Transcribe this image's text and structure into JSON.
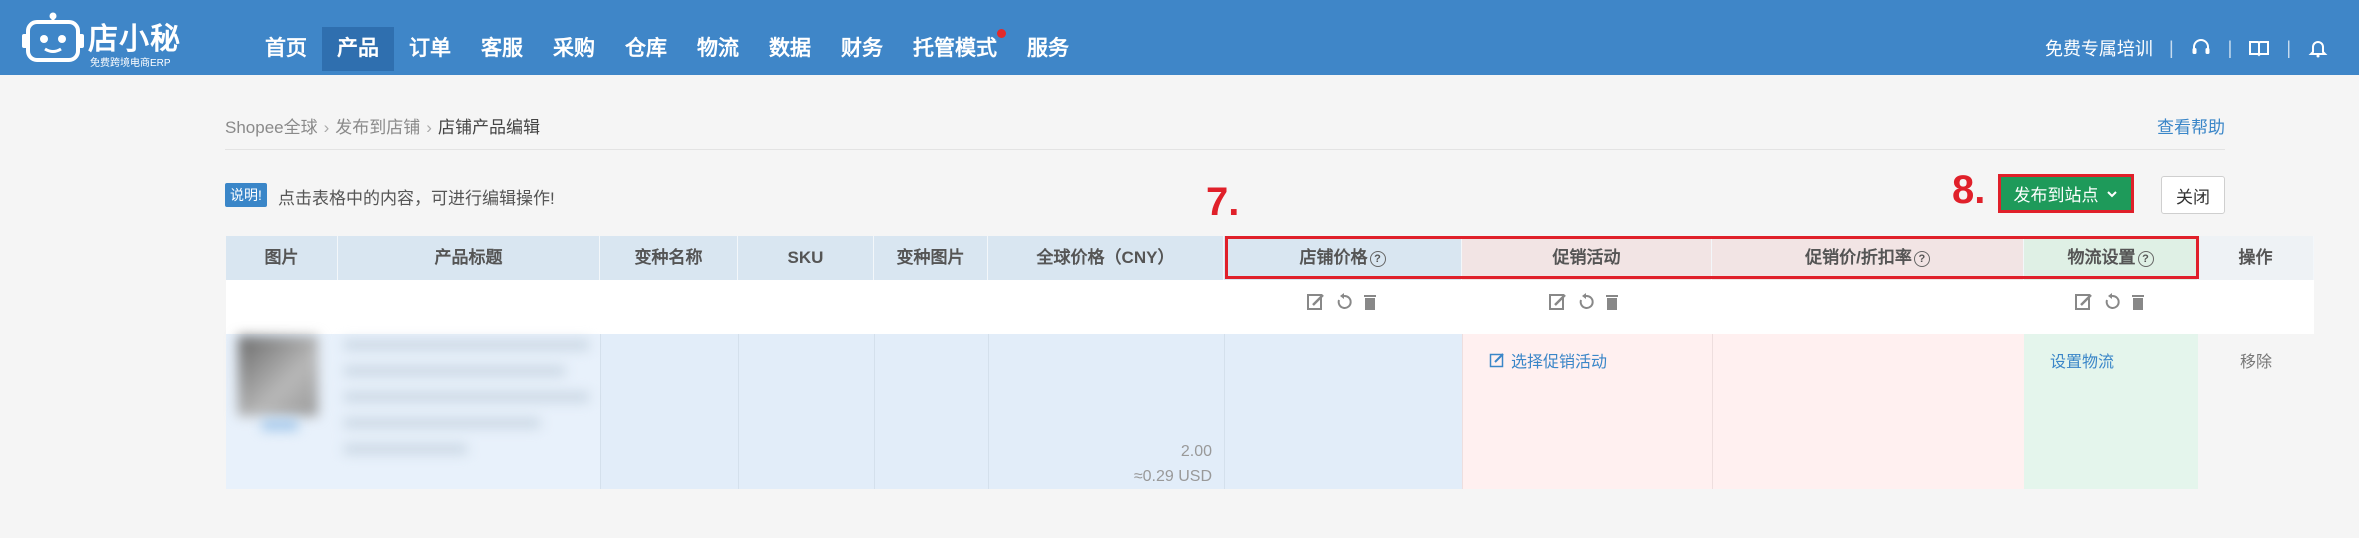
{
  "app": {
    "logo_name": "店小秘",
    "logo_sub": "免费跨境电商ERP"
  },
  "nav": {
    "items": [
      {
        "label": "首页"
      },
      {
        "label": "产品"
      },
      {
        "label": "订单"
      },
      {
        "label": "客服"
      },
      {
        "label": "采购"
      },
      {
        "label": "仓库"
      },
      {
        "label": "物流"
      },
      {
        "label": "数据"
      },
      {
        "label": "财务"
      },
      {
        "label": "托管模式"
      },
      {
        "label": "服务"
      }
    ],
    "active": "产品",
    "right_link": "免费专属培训",
    "icons": [
      "headset-icon",
      "book-icon",
      "bell-icon"
    ]
  },
  "breadcrumb": {
    "items": [
      "Shopee全球",
      "发布到店铺",
      "店铺产品编辑"
    ],
    "help": "查看帮助"
  },
  "notice": {
    "badge": "说明!",
    "text": "点击表格中的内容，可进行编辑操作!"
  },
  "annotations": {
    "step7": "7.",
    "step8": "8."
  },
  "actions": {
    "publish": "发布到站点",
    "close": "关闭"
  },
  "table": {
    "headers": [
      "图片",
      "产品标题",
      "变种名称",
      "SKU",
      "变种图片",
      "全球价格（CNY）",
      "店铺价格",
      "促销活动",
      "促销价/折扣率",
      "物流设置",
      "操作"
    ],
    "row": {
      "global_price": "2.00",
      "global_price_usd": "≈0.29 USD",
      "promo_action": "选择促销活动",
      "shipping_action": "设置物流",
      "remove": "移除"
    }
  },
  "colors": {
    "topbar": "#3f86c8",
    "header_blue": "#d9e6f1",
    "header_pink": "#f2e4e4",
    "header_green": "#dff0e5",
    "col_blue": "#e2edf9",
    "col_pink": "#fff0f0",
    "col_green": "#e4f5ec",
    "annotation_red": "#e0202a",
    "publish_green": "#1e9a5a"
  }
}
